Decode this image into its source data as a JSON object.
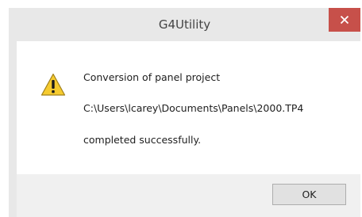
{
  "window": {
    "title": "G4Utility",
    "close_icon": "close-icon",
    "accent_close": "#c7504a"
  },
  "message": {
    "icon": "warning-icon",
    "line1": "Conversion of panel project",
    "line2": "C:\\Users\\lcarey\\Documents\\Panels\\2000.TP4",
    "line3": "completed successfully."
  },
  "buttons": {
    "ok_label": "OK"
  }
}
